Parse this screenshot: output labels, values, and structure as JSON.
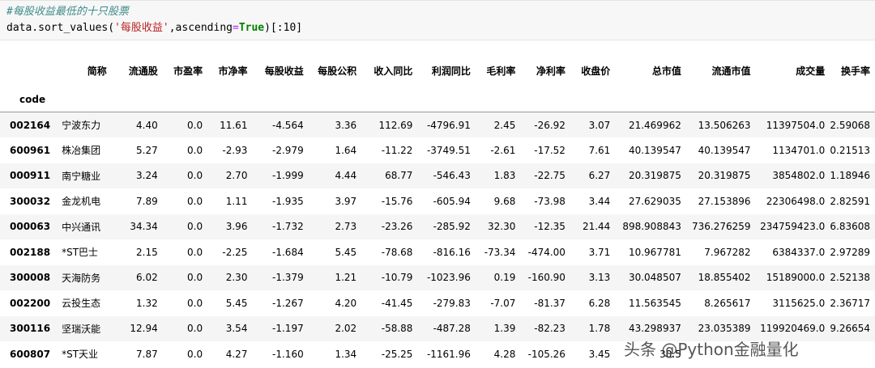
{
  "code": {
    "comment": "#每股收益最低的十只股票",
    "line2_prefix": "data.sort_values(",
    "line2_string": "'每股收益'",
    "line2_mid": ",ascending",
    "line2_eq": "=",
    "line2_kw": "True",
    "line2_suffix": ")[:10]"
  },
  "table": {
    "index_name": "code",
    "columns": [
      "简称",
      "流通股",
      "市盈率",
      "市净率",
      "每股收益",
      "每股公积",
      "收入同比",
      "利润同比",
      "毛利率",
      "净利率",
      "收盘价",
      "总市值",
      "流通市值",
      "成交量",
      "换手率"
    ],
    "rows": [
      {
        "code": "002164",
        "cells": [
          "宁波东力",
          "4.40",
          "0.0",
          "11.61",
          "-4.564",
          "3.36",
          "112.69",
          "-4796.91",
          "2.45",
          "-26.92",
          "3.07",
          "21.469962",
          "13.506263",
          "11397504.0",
          "2.59068"
        ]
      },
      {
        "code": "600961",
        "cells": [
          "株冶集团",
          "5.27",
          "0.0",
          "-2.93",
          "-2.979",
          "1.64",
          "-11.22",
          "-3749.51",
          "-2.61",
          "-17.52",
          "7.61",
          "40.139547",
          "40.139547",
          "1134701.0",
          "0.21513"
        ]
      },
      {
        "code": "000911",
        "cells": [
          "南宁糖业",
          "3.24",
          "0.0",
          "2.70",
          "-1.999",
          "4.44",
          "68.77",
          "-546.43",
          "1.83",
          "-22.75",
          "6.27",
          "20.319875",
          "20.319875",
          "3854802.0",
          "1.18946"
        ]
      },
      {
        "code": "300032",
        "cells": [
          "金龙机电",
          "7.89",
          "0.0",
          "1.11",
          "-1.935",
          "3.97",
          "-15.76",
          "-605.94",
          "9.68",
          "-73.98",
          "3.44",
          "27.629035",
          "27.153896",
          "22306498.0",
          "2.82591"
        ]
      },
      {
        "code": "000063",
        "cells": [
          "中兴通讯",
          "34.34",
          "0.0",
          "3.96",
          "-1.732",
          "2.73",
          "-23.26",
          "-285.92",
          "32.30",
          "-12.35",
          "21.44",
          "898.908843",
          "736.276259",
          "234759423.0",
          "6.83608"
        ]
      },
      {
        "code": "002188",
        "cells": [
          "*ST巴士",
          "2.15",
          "0.0",
          "-2.25",
          "-1.684",
          "5.45",
          "-78.68",
          "-816.16",
          "-73.34",
          "-474.00",
          "3.71",
          "10.967781",
          "7.967282",
          "6384337.0",
          "2.97289"
        ]
      },
      {
        "code": "300008",
        "cells": [
          "天海防务",
          "6.02",
          "0.0",
          "2.30",
          "-1.379",
          "1.21",
          "-10.79",
          "-1023.96",
          "0.19",
          "-160.90",
          "3.13",
          "30.048507",
          "18.855402",
          "15189000.0",
          "2.52138"
        ]
      },
      {
        "code": "002200",
        "cells": [
          "云投生态",
          "1.32",
          "0.0",
          "5.45",
          "-1.267",
          "4.20",
          "-41.45",
          "-279.83",
          "-7.07",
          "-81.37",
          "6.28",
          "11.563545",
          "8.265617",
          "3115625.0",
          "2.36717"
        ]
      },
      {
        "code": "300116",
        "cells": [
          "坚瑞沃能",
          "12.94",
          "0.0",
          "3.54",
          "-1.197",
          "2.02",
          "-58.88",
          "-487.28",
          "1.39",
          "-82.23",
          "1.78",
          "43.298937",
          "23.035389",
          "119920469.0",
          "9.26654"
        ]
      },
      {
        "code": "600807",
        "cells": [
          "*ST天业",
          "7.87",
          "0.0",
          "4.27",
          "-1.160",
          "1.34",
          "-25.25",
          "-1161.96",
          "4.28",
          "-105.26",
          "3.45",
          "30.5",
          "",
          "",
          ""
        ]
      }
    ]
  },
  "watermark": "头条 @Python金融量化"
}
